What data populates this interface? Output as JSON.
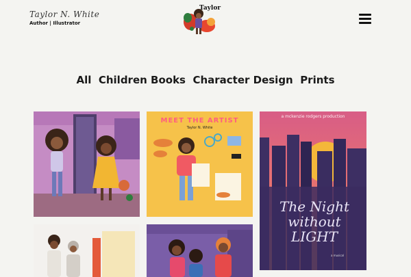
{
  "brand": {
    "signature": "Taylor N. White",
    "role": "Author | Illustrator"
  },
  "logo": {
    "word": "Taylor"
  },
  "nav": {
    "menu_icon": "hamburger-menu-icon"
  },
  "filters": [
    {
      "label": "All"
    },
    {
      "label": "Children Books"
    },
    {
      "label": "Character Design"
    },
    {
      "label": "Prints"
    }
  ],
  "gallery": {
    "tile2": {
      "title": "MEET THE ARTIST",
      "subtitle": "Taylor N. White"
    },
    "tile3": {
      "production": "a mckenzie rodgers production",
      "title": "The Night without LIGHT",
      "footer": "a musical"
    }
  },
  "colors": {
    "background": "#f4f4f1",
    "text": "#111111"
  }
}
